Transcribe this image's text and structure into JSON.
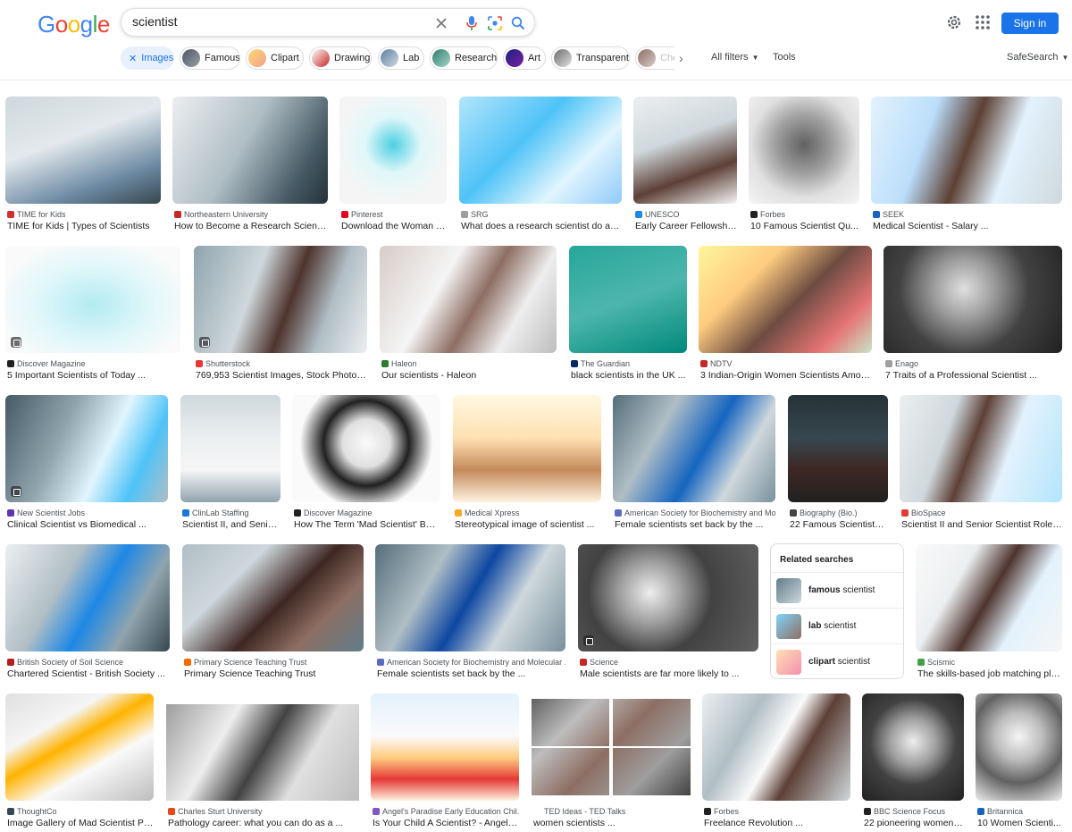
{
  "header": {
    "logo": "Google",
    "search_value": "scientist",
    "sign_in": "Sign in"
  },
  "chips": [
    {
      "label": "Images",
      "active": true
    },
    {
      "label": "Famous"
    },
    {
      "label": "Clipart"
    },
    {
      "label": "Drawing"
    },
    {
      "label": "Lab"
    },
    {
      "label": "Research"
    },
    {
      "label": "Art"
    },
    {
      "label": "Transparent"
    },
    {
      "label": "Che"
    }
  ],
  "filters": {
    "all_filters": "All filters",
    "tools": "Tools",
    "safesearch": "SafeSearch"
  },
  "results": [
    {
      "source": "TIME for Kids",
      "title": "TIME for Kids | Types of Scientists"
    },
    {
      "source": "Northeastern University",
      "title": "How to Become a Research Scientis..."
    },
    {
      "source": "Pinterest",
      "title": "Download the Woman S..."
    },
    {
      "source": "SRG",
      "title": "What does a research scientist do and ..."
    },
    {
      "source": "UNESCO",
      "title": "Early Career Fellowship..."
    },
    {
      "source": "Forbes",
      "title": "10 Famous Scientist Qu..."
    },
    {
      "source": "SEEK",
      "title": "Medical Scientist - Salary ..."
    },
    {
      "source": "Discover Magazine",
      "title": "5 Important Scientists of Today ..."
    },
    {
      "source": "Shutterstock",
      "title": "769,953 Scientist Images, Stock Photos ..."
    },
    {
      "source": "Haleon",
      "title": "Our scientists - Haleon"
    },
    {
      "source": "The Guardian",
      "title": "black scientists in the UK ..."
    },
    {
      "source": "NDTV",
      "title": "3 Indian-Origin Women Scientists Among ..."
    },
    {
      "source": "Enago",
      "title": "7 Traits of a Professional Scientist ..."
    },
    {
      "source": "New Scientist Jobs",
      "title": "Clinical Scientist vs Biomedical ..."
    },
    {
      "source": "ClinLab Staffing",
      "title": "Scientist II, and Senio..."
    },
    {
      "source": "Discover Magazine",
      "title": "How The Term 'Mad Scientist' Beg..."
    },
    {
      "source": "Medical Xpress",
      "title": "Stereotypical image of scientist ..."
    },
    {
      "source": "American Society for Biochemistry and Mo...",
      "title": "Female scientists set back by the ..."
    },
    {
      "source": "Biography (Bio.)",
      "title": "22 Famous Scientists:..."
    },
    {
      "source": "BioSpace",
      "title": "Scientist II and Senior Scientist Roles ..."
    },
    {
      "source": "British Society of Soil Science",
      "title": "Chartered Scientist - British Society ..."
    },
    {
      "source": "Primary Science Teaching Trust",
      "title": "Primary Science Teaching Trust"
    },
    {
      "source": "American Society for Biochemistry and Molecular ...",
      "title": "Female scientists set back by the ..."
    },
    {
      "source": "Science",
      "title": "Male scientists are far more likely to ..."
    },
    {
      "source": "Scismic",
      "title": "The skills-based job matching platf..."
    },
    {
      "source": "ThoughtCo",
      "title": "Image Gallery of Mad Scientist Pic..."
    },
    {
      "source": "Charles Sturt University",
      "title": "Pathology career: what you can do as a ..."
    },
    {
      "source": "Angel's Paradise Early Education Chil...",
      "title": "Is Your Child A Scientist? - Angel's ..."
    },
    {
      "source": "TED Ideas - TED Talks",
      "title": "women scientists ..."
    },
    {
      "source": "Forbes",
      "title": "Freelance Revolution ..."
    },
    {
      "source": "BBC Science Focus",
      "title": "22 pioneering women i..."
    },
    {
      "source": "Britannica",
      "title": "10 Women Scienti..."
    }
  ],
  "related": {
    "heading": "Related searches",
    "items": [
      {
        "bold": "famous",
        "rest": " scientist"
      },
      {
        "bold": "lab",
        "rest": " scientist"
      },
      {
        "bold": "clipart",
        "rest": " scientist"
      }
    ]
  }
}
